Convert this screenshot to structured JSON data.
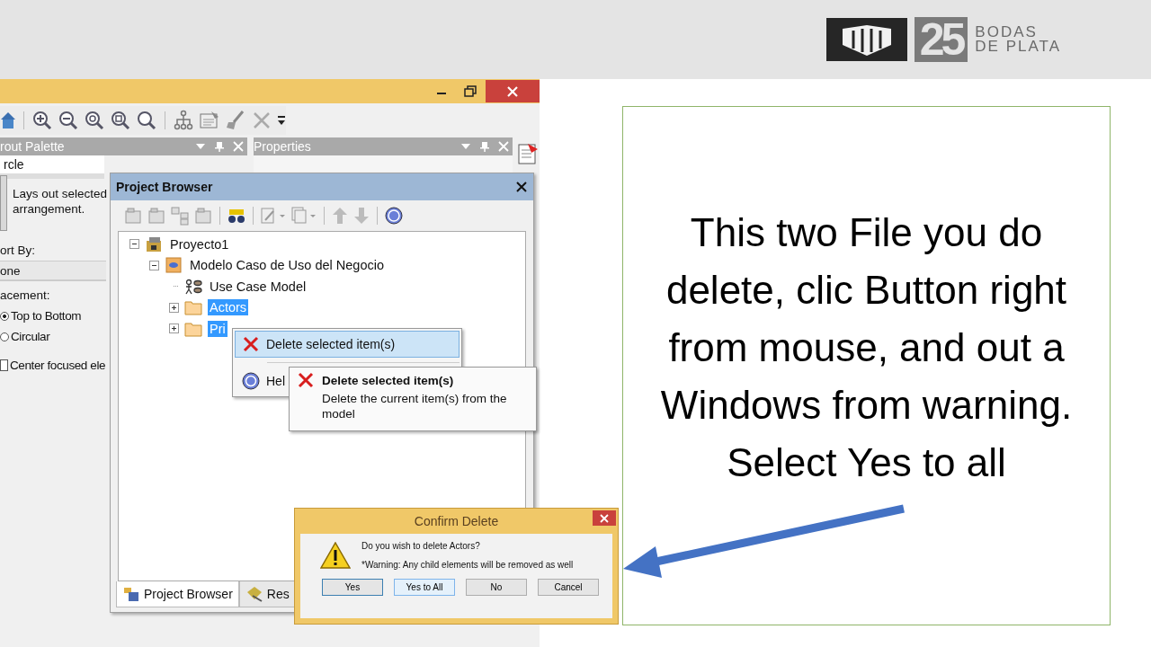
{
  "header": {
    "logo": {
      "number": "25",
      "line1": "BODAS",
      "line2": "DE PLATA"
    }
  },
  "app": {
    "layout_palette": {
      "title": "rout Palette",
      "selector": "rcle",
      "description": "Lays out selected arrangement.",
      "sort_label": "ort By:",
      "sort_value": "one",
      "placement_label": "acement:",
      "placement_options": [
        {
          "label": "Top to Bottom",
          "selected": true
        },
        {
          "label": "Circular",
          "selected": false
        }
      ],
      "center_checkbox": {
        "label": "Center focused ele",
        "checked": false
      }
    },
    "properties": {
      "title": "Properties"
    },
    "project_browser": {
      "title": "Project Browser",
      "tree": [
        {
          "label": "Proyecto1",
          "kind": "project",
          "expanded": true,
          "selected": false,
          "children": [
            {
              "label": "Modelo Caso de Uso del Negocio",
              "kind": "model",
              "expanded": true,
              "selected": false,
              "children": [
                {
                  "label": "Use Case Model",
                  "kind": "diagram",
                  "selected": false
                },
                {
                  "label": "Actors",
                  "kind": "folder",
                  "expanded": false,
                  "selected": true
                },
                {
                  "label": "Pri",
                  "kind": "folder",
                  "expanded": false,
                  "selected": true
                }
              ]
            }
          ]
        }
      ],
      "tabs": [
        {
          "label": "Project Browser",
          "selected": true
        },
        {
          "label": "Res",
          "selected": false
        }
      ]
    },
    "context_menu": {
      "items": [
        {
          "label": "Delete selected item(s)",
          "kind": "delete",
          "highlighted": true
        },
        {
          "label": "Hel",
          "kind": "help",
          "highlighted": false
        }
      ]
    },
    "tooltip": {
      "title": "Delete selected item(s)",
      "text": "Delete the current item(s) from the model"
    },
    "dialog": {
      "title": "Confirm Delete",
      "message": "Do you wish to delete Actors?",
      "warning": "*Warning: Any child elements will be removed as well",
      "buttons": [
        {
          "label": "Yes",
          "focused": true,
          "hovered": false
        },
        {
          "label": "Yes to All",
          "focused": false,
          "hovered": true
        },
        {
          "label": "No",
          "focused": false,
          "hovered": false
        },
        {
          "label": "Cancel",
          "focused": false,
          "hovered": false
        }
      ]
    }
  },
  "note": {
    "text": "This two File you do delete, clic Button right from mouse, and out a Windows from warning. Select Yes to all"
  }
}
